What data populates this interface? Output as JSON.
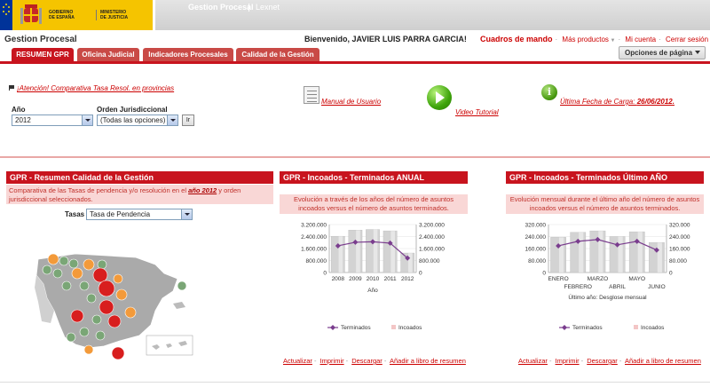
{
  "banner": {
    "gov_line1": "GOBIERNO",
    "gov_line2": "DE ESPAÑA",
    "min_line1": "MINISTERIO",
    "min_line2": "DE JUSTICIA",
    "tabs": [
      "Gestion Procesal",
      "Lexnet"
    ]
  },
  "header": {
    "title": "Gestion Procesal",
    "welcome": "Bienvenido, JAVIER LUIS PARRA GARCIA!",
    "links": {
      "cuadros": "Cuadros de mando",
      "mas": "Más productos",
      "cuenta": "Mi cuenta",
      "cerrar": "Cerrar sesión"
    }
  },
  "tabs": [
    {
      "label": "RESUMEN GPR",
      "active": true
    },
    {
      "label": "Oficina Judicial",
      "active": false
    },
    {
      "label": "Indicadores Procesales",
      "active": false
    },
    {
      "label": "Calidad de la Gestión",
      "active": false
    }
  ],
  "opciones_label": "Opciones de página",
  "filters": {
    "alert": "¡Atención! Comparativa Tasa Resol. en provincias",
    "anio_label": "Año",
    "anio_value": "2012",
    "orden_label": "Orden Jurisdiccional",
    "orden_value": "(Todas las opciones)",
    "ir_label": "Ir"
  },
  "quick_links": {
    "manual": "Manual de Usuario",
    "video": "Video Tutorial",
    "fecha_prefix": "Última Fecha de Carga: ",
    "fecha_value": "26/06/2012."
  },
  "panel1": {
    "title": "GPR - Resumen Calidad de la Gestión",
    "desc_a": "Comparativa de las Tasas de pendencia y/o resolución en el ",
    "desc_year": "año 2012",
    "desc_b": " y orden jurisdiccional seleccionados.",
    "tasas_label": "Tasas",
    "tasas_value": "Tasa de Pendencia"
  },
  "panel2": {
    "title": "GPR - Incoados - Terminados ANUAL",
    "desc": "Evolución a través de los años del número de asuntos incoados versus el número de asuntos terminados."
  },
  "panel3": {
    "title": "GPR - Incoados - Terminados Último AÑO",
    "desc": "Evolución mensual durante el último año del número de asuntos incoados versus el número de asuntos terminados."
  },
  "footer_links": [
    "Actualizar",
    "Imprimir",
    "Descargar",
    "Añadir a libro de resumen"
  ],
  "colors": {
    "accent": "#c8141e",
    "bar": "#d3d3d3",
    "line": "#7a3d8e",
    "pink_band": "#f9d7d6"
  },
  "chart_data": [
    {
      "type": "bar",
      "title": "GPR - Incoados - Terminados ANUAL",
      "xlabel": "Año",
      "ylabel": "",
      "categories": [
        "2008",
        "2009",
        "2010",
        "2011",
        "2012"
      ],
      "yticks": [
        "0",
        "800.000",
        "1.600.000",
        "2.400.000",
        "3.200.000"
      ],
      "ylim": [
        0,
        3200000
      ],
      "series": [
        {
          "name": "Incoados",
          "kind": "bar",
          "values": [
            2420000,
            2830000,
            2870000,
            2780000,
            1300000
          ]
        },
        {
          "name": "Terminados",
          "kind": "line",
          "values": [
            1780000,
            2020000,
            2050000,
            1960000,
            960000
          ]
        }
      ],
      "legend": "bottom"
    },
    {
      "type": "bar",
      "title": "GPR - Incoados - Terminados Último AÑO",
      "xlabel": "Último año: Desglose mensual",
      "ylabel": "",
      "categories": [
        "ENERO",
        "FEBRERO",
        "MARZO",
        "ABRIL",
        "MAYO",
        "JUNIO"
      ],
      "yticks": [
        "0",
        "80.000",
        "160.000",
        "240.000",
        "320.000"
      ],
      "ylim": [
        0,
        320000
      ],
      "series": [
        {
          "name": "Incoados",
          "kind": "bar",
          "values": [
            235000,
            268000,
            278000,
            240000,
            272000,
            200000
          ]
        },
        {
          "name": "Terminados",
          "kind": "line",
          "values": [
            178000,
            208000,
            220000,
            185000,
            208000,
            150000
          ]
        }
      ],
      "legend": "bottom"
    }
  ]
}
